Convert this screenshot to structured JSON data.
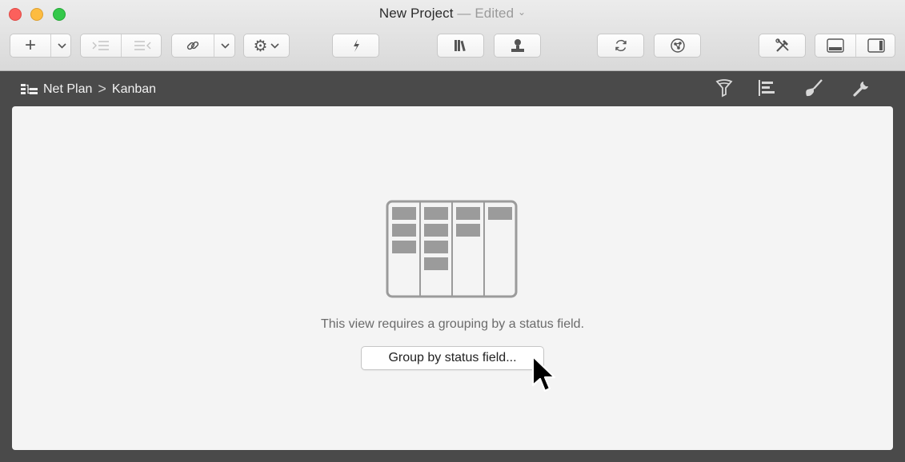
{
  "window": {
    "title": "New Project",
    "title_separator": " — ",
    "status": "Edited",
    "status_chevron": "⌄"
  },
  "toolbar": {
    "add_symbol": "+",
    "buttons": [
      {
        "icon": "add-icon"
      },
      {
        "icon": "indent-icon"
      },
      {
        "icon": "outdent-icon"
      },
      {
        "icon": "link-icon"
      },
      {
        "icon": "gear-icon"
      },
      {
        "icon": "lightning-icon"
      },
      {
        "icon": "library-icon"
      },
      {
        "icon": "person-icon"
      },
      {
        "icon": "refresh-icon"
      },
      {
        "icon": "network-icon"
      },
      {
        "icon": "tools-icon"
      },
      {
        "icon": "bottom-panel-icon"
      },
      {
        "icon": "right-panel-icon"
      }
    ]
  },
  "breadcrumb": {
    "root": "Net Plan",
    "separator": ">",
    "current": "Kanban"
  },
  "view_icons": [
    "filter-icon",
    "gantt-icon",
    "brush-icon",
    "wrench-icon"
  ],
  "empty_state": {
    "message": "This view requires a grouping by a status field.",
    "button_label": "Group by status field..."
  },
  "colors": {
    "content_bg": "#f4f4f4",
    "chrome_dark": "#4a4a4a",
    "kanban_card": "#9b9b9b"
  }
}
